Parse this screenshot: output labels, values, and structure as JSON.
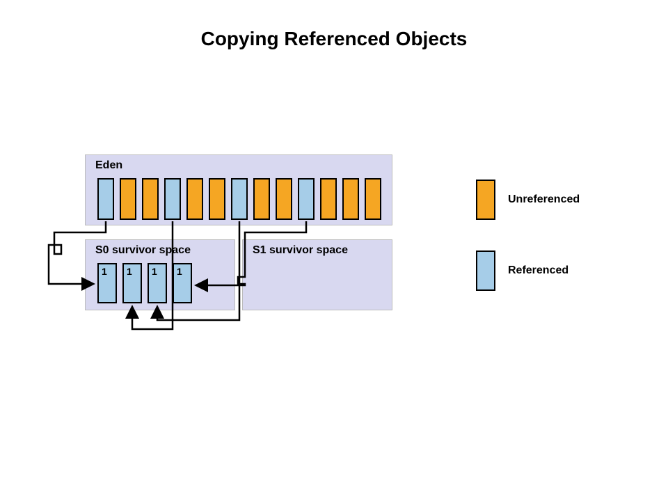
{
  "title": "Copying Referenced Objects",
  "eden": {
    "label": "Eden",
    "blocks": [
      {
        "type": "blue"
      },
      {
        "type": "orange"
      },
      {
        "type": "orange"
      },
      {
        "type": "blue"
      },
      {
        "type": "orange"
      },
      {
        "type": "orange"
      },
      {
        "type": "blue"
      },
      {
        "type": "orange"
      },
      {
        "type": "orange"
      },
      {
        "type": "blue"
      },
      {
        "type": "orange"
      },
      {
        "type": "orange"
      },
      {
        "type": "orange"
      }
    ]
  },
  "s0": {
    "label": "S0 survivor space",
    "blocks": [
      {
        "value": "1"
      },
      {
        "value": "1"
      },
      {
        "value": "1"
      },
      {
        "value": "1"
      }
    ]
  },
  "s1": {
    "label": "S1 survivor space"
  },
  "legend": {
    "unreferenced": "Unreferenced",
    "referenced": "Referenced"
  },
  "colors": {
    "panel": "#d8d8f0",
    "unreferenced": "#f5a623",
    "referenced": "#a6cde8"
  }
}
